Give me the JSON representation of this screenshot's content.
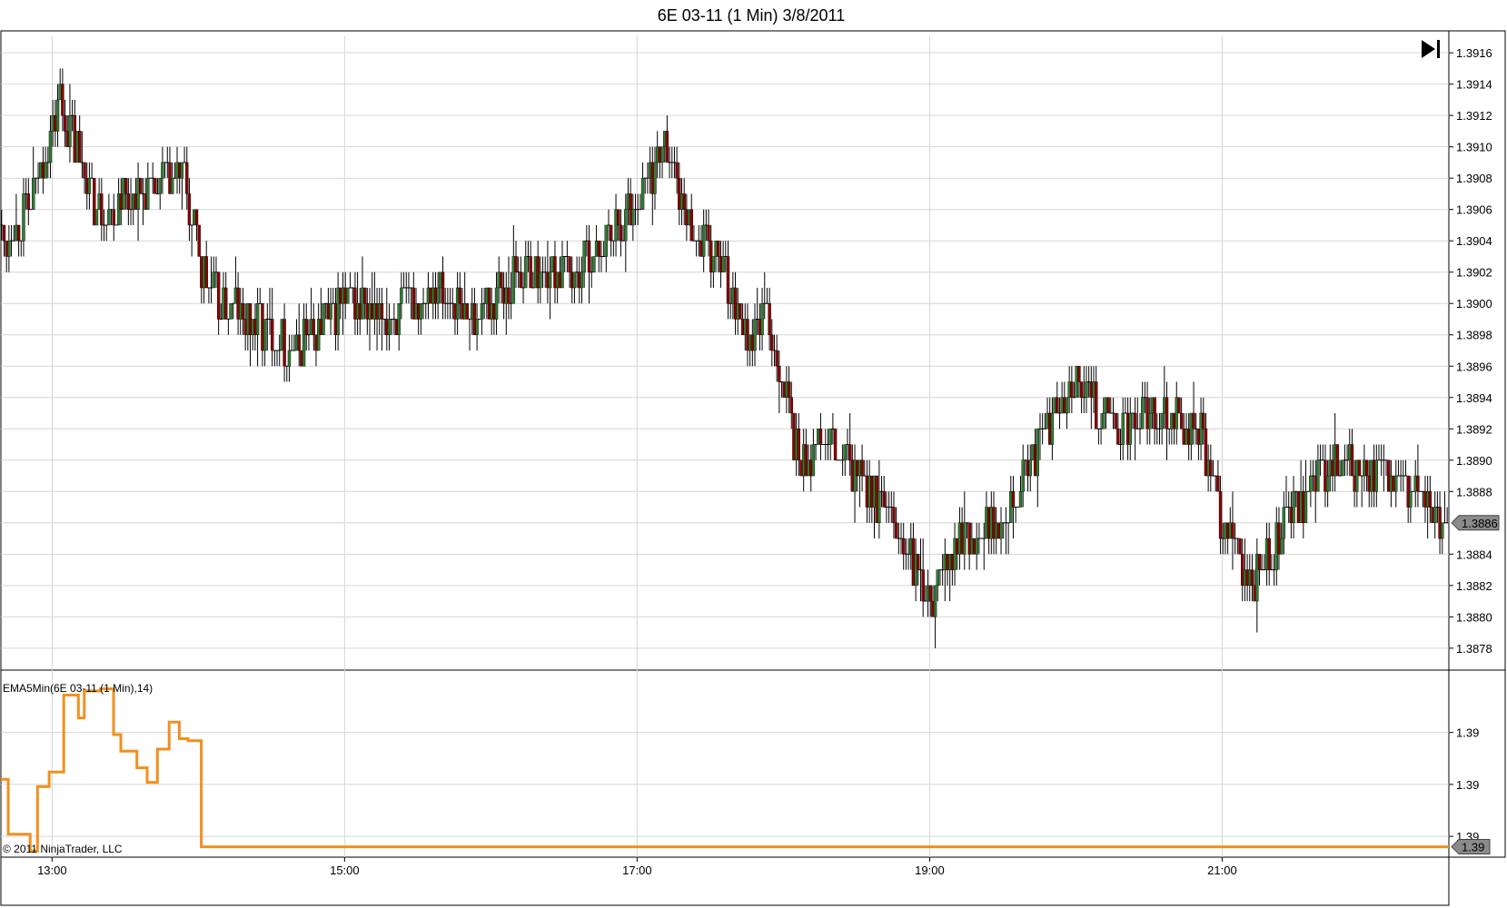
{
  "window": {
    "title": "6E 03-11 (1 Min)  3/8/2011"
  },
  "colors": {
    "up_bar": "#2e7d32",
    "down_bar": "#8b0000",
    "wick": "#000000",
    "indicator": "#f0901e",
    "grid": "#d6d6d6",
    "price_marker": "#8a8a8a"
  },
  "buttons": {
    "go_to_end_icon": "skip-to-end-icon"
  },
  "chart_data": [
    {
      "type": "candlestick",
      "panel": "price",
      "title": "6E 03-11 (1 Min)  3/8/2011",
      "x_ticks": [
        "13:00",
        "15:00",
        "17:00",
        "19:00",
        "21:00"
      ],
      "x_tick_hours": [
        13,
        15,
        17,
        19,
        21
      ],
      "x_range_hours": [
        12.65,
        22.55
      ],
      "y_ticks": [
        "1.3916",
        "1.3914",
        "1.3912",
        "1.3910",
        "1.3908",
        "1.3906",
        "1.3904",
        "1.3902",
        "1.3900",
        "1.3898",
        "1.3896",
        "1.3894",
        "1.3892",
        "1.3890",
        "1.3888",
        "1.3884",
        "1.3882",
        "1.3880",
        "1.3878"
      ],
      "ylim": [
        1.38766,
        1.39174
      ],
      "last_price_label": "1.3886",
      "last_price": 1.3886,
      "grid": true,
      "path_hours": [
        12.65,
        12.85,
        13.05,
        13.3,
        13.6,
        13.9,
        14.05,
        14.35,
        14.65,
        15.0,
        15.3,
        15.6,
        15.85,
        16.2,
        16.55,
        16.9,
        17.2,
        17.35,
        17.6,
        17.75,
        17.9,
        18.1,
        18.3,
        18.6,
        18.85,
        19.0,
        19.2,
        19.45,
        19.7,
        19.95,
        20.3,
        20.55,
        20.85,
        21.0,
        21.2,
        21.45,
        21.75,
        22.0,
        22.3,
        22.55
      ],
      "path_prices": [
        1.3904,
        1.3906,
        1.3913,
        1.3906,
        1.3907,
        1.3908,
        1.3901,
        1.3899,
        1.3897,
        1.39,
        1.3899,
        1.3901,
        1.3899,
        1.3902,
        1.3902,
        1.3905,
        1.391,
        1.3905,
        1.3902,
        1.3898,
        1.3899,
        1.389,
        1.3891,
        1.3888,
        1.3884,
        1.3881,
        1.3885,
        1.3886,
        1.389,
        1.3895,
        1.3892,
        1.3893,
        1.3892,
        1.3886,
        1.3882,
        1.3886,
        1.389,
        1.3889,
        1.3888,
        1.3886
      ]
    },
    {
      "type": "line",
      "panel": "indicator",
      "series": [
        {
          "name": "EMA5Min(6E 03-11 (1 Min),14)"
        }
      ],
      "label": "EMA5Min(6E 03-11 (1 Min),14)",
      "y_ticks": [
        "1.39",
        "1.39",
        "1.39"
      ],
      "y_tick_levels": [
        1.0,
        0.5,
        0.0
      ],
      "last_value_label": "1.39",
      "x_hours": [
        12.65,
        12.7,
        12.7,
        12.85,
        12.85,
        12.9,
        12.9,
        12.98,
        12.98,
        13.08,
        13.08,
        13.18,
        13.18,
        13.22,
        13.22,
        13.33,
        13.33,
        13.42,
        13.42,
        13.47,
        13.47,
        13.58,
        13.58,
        13.65,
        13.65,
        13.72,
        13.72,
        13.8,
        13.8,
        13.87,
        13.87,
        13.93,
        13.93,
        14.02,
        14.02,
        22.55
      ],
      "y_levels": [
        0.55,
        0.55,
        0.02,
        0.02,
        -0.14,
        -0.14,
        0.48,
        0.48,
        0.62,
        0.62,
        1.36,
        1.36,
        1.14,
        1.14,
        1.4,
        1.4,
        1.42,
        1.42,
        0.98,
        0.98,
        0.82,
        0.82,
        0.66,
        0.66,
        0.52,
        0.52,
        0.84,
        0.84,
        1.1,
        1.1,
        0.94,
        0.94,
        0.92,
        0.92,
        -0.1,
        -0.1
      ]
    }
  ],
  "footer": {
    "copyright": "© 2011 NinjaTrader, LLC"
  }
}
